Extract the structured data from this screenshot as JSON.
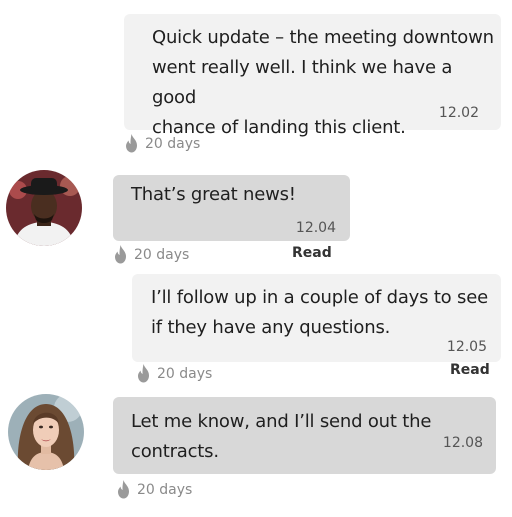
{
  "messages": [
    {
      "direction": "outgoing",
      "lines": [
        "Quick update – the meeting downtown",
        "went really well. I think we have a good",
        "chance of landing this client."
      ],
      "time": "12.02",
      "expiry": "20 days",
      "status": ""
    },
    {
      "direction": "incoming",
      "lines": [
        "That’s great news!"
      ],
      "time": "12.04",
      "expiry": "20 days",
      "status": "Read",
      "avatar_icon": "man-with-hat-avatar"
    },
    {
      "direction": "outgoing",
      "lines": [
        "I’ll follow up in a couple of days to see",
        "if they have any questions."
      ],
      "time": "12.05",
      "expiry": "20 days",
      "status": "Read"
    },
    {
      "direction": "incoming",
      "lines": [
        "Let me know, and I’ll send out the",
        "contracts."
      ],
      "time": "12.08",
      "expiry": "20 days",
      "status": "",
      "avatar_icon": "woman-avatar"
    }
  ],
  "icons": {
    "expiry": "flame-icon"
  },
  "colors": {
    "outgoing_bubble": "#f2f2f2",
    "incoming_bubble": "#d8d8d8",
    "meta_text": "#8a8a8a"
  }
}
